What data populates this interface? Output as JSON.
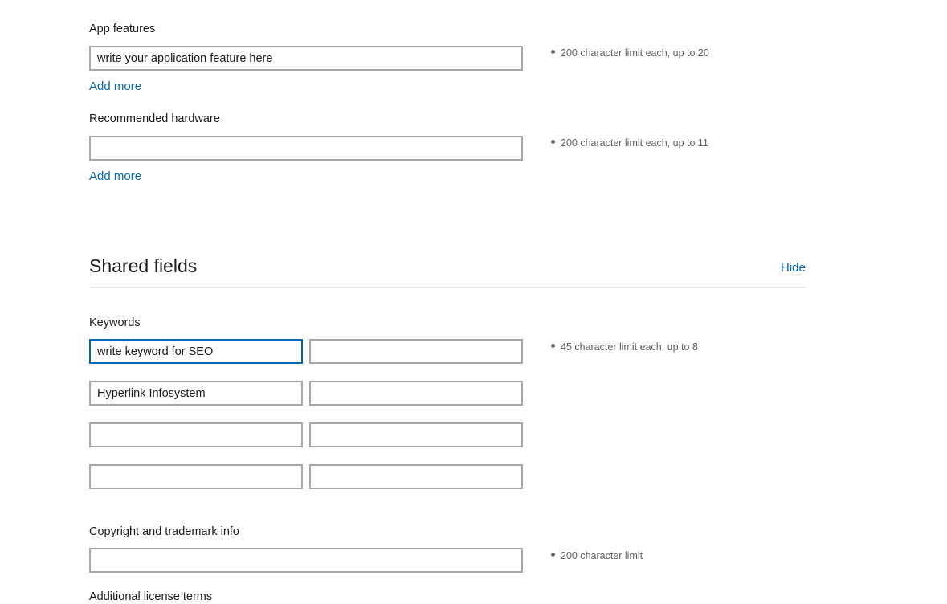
{
  "app_features": {
    "label": "App features",
    "value": "write your application feature here",
    "add_more": "Add more",
    "hint": "200 character limit each, up to 20"
  },
  "recommended_hardware": {
    "label": "Recommended hardware",
    "value": "",
    "add_more": "Add more",
    "hint": "200 character limit each, up to 11"
  },
  "shared_fields": {
    "title": "Shared fields",
    "toggle": "Hide"
  },
  "keywords": {
    "label": "Keywords",
    "hint": "45 character limit each, up to 8",
    "values": [
      "write keyword for SEO",
      "",
      "Hyperlink Infosystem",
      "",
      "",
      "",
      "",
      ""
    ]
  },
  "copyright": {
    "label": "Copyright and trademark info",
    "value": "",
    "hint": "200 character limit"
  },
  "additional_license": {
    "label": "Additional license terms"
  }
}
